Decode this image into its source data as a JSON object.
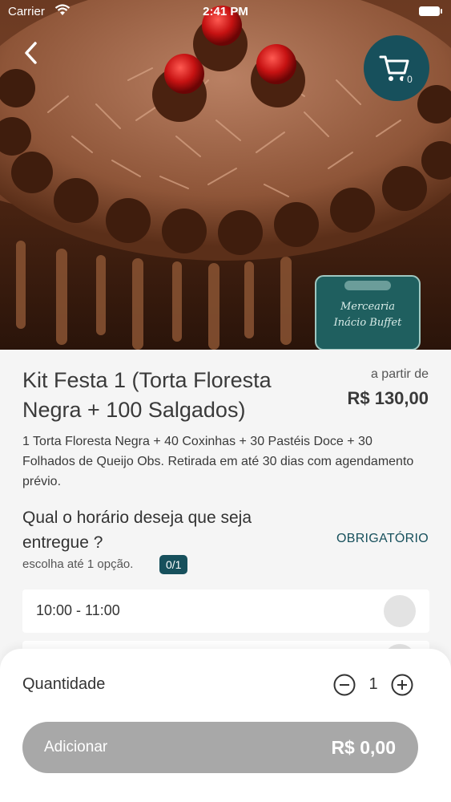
{
  "status_bar": {
    "carrier": "Carrier",
    "time": "2:41 PM"
  },
  "header": {
    "cart_count": "0"
  },
  "hero": {
    "logo_lines": [
      "Mercearia",
      "Inácio Buffet"
    ]
  },
  "product": {
    "title": "Kit Festa 1 (Torta Floresta Negra + 100 Salgados)",
    "price_prefix": "a partir de",
    "price": "R$ 130,00",
    "description": "1 Torta Floresta Negra + 40 Coxinhas + 30 Pastéis Doce + 30 Folhados de Queijo Obs. Retirada em até 30 dias com agendamento prévio."
  },
  "question": {
    "title": "Qual o horário deseja que seja entregue ?",
    "required": "OBRIGATÓRIO",
    "hint": "escolha até 1 opção.",
    "counter": "0/1",
    "options": [
      {
        "label": "10:00 - 11:00"
      }
    ]
  },
  "footer": {
    "quantity_label": "Quantidade",
    "quantity": "1",
    "add_label": "Adicionar",
    "total": "R$ 0,00"
  },
  "colors": {
    "accent": "#17505c",
    "button_disabled": "#a8a8a8",
    "background": "#f5f5f5"
  }
}
